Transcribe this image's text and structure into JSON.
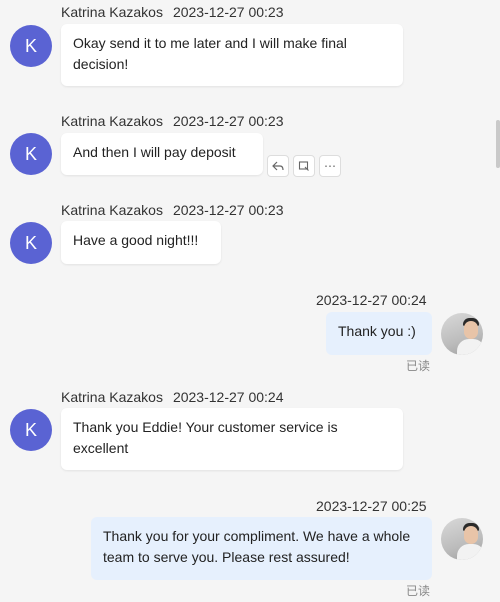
{
  "contact": {
    "name": "Katrina Kazakos",
    "initial": "K"
  },
  "messages": [
    {
      "time": "2023-12-27 00:23",
      "text": "Okay send it to me later and I will make final decision!"
    },
    {
      "time": "2023-12-27 00:23",
      "text": "And then I will pay deposit"
    },
    {
      "time": "2023-12-27 00:23",
      "text": "Have a good night!!!"
    },
    {
      "time": "2023-12-27 00:24",
      "text": "Thank you :)",
      "status": "已读"
    },
    {
      "time": "2023-12-27 00:24",
      "text": "Thank you Eddie! Your customer service is excellent"
    },
    {
      "time": "2023-12-27 00:25",
      "text": "Thank you for your compliment. We have a whole team to serve you. Please rest assured!",
      "status": "已读"
    }
  ],
  "hover_actions": {
    "reply_icon": "reply-icon",
    "forward_icon": "forward-icon",
    "more_icon": "more-icon"
  }
}
